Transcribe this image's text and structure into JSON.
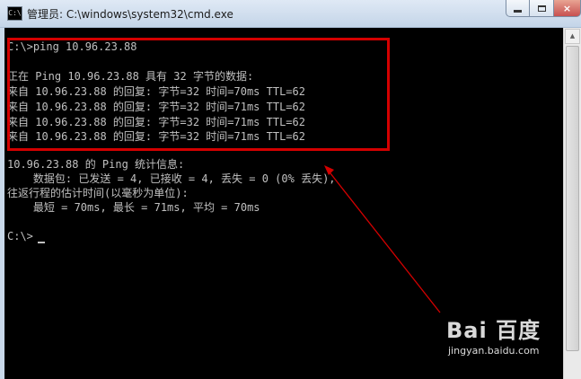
{
  "window": {
    "title": "管理员: C:\\windows\\system32\\cmd.exe",
    "app_icon_text": "C:\\",
    "controls": {
      "minimize": "minimize-icon",
      "maximize": "maximize-icon",
      "close_label": "×"
    }
  },
  "console": {
    "lines": [
      "C:\\>ping 10.96.23.88",
      "",
      "正在 Ping 10.96.23.88 具有 32 字节的数据:",
      "来自 10.96.23.88 的回复: 字节=32 时间=70ms TTL=62",
      "来自 10.96.23.88 的回复: 字节=32 时间=71ms TTL=62",
      "来自 10.96.23.88 的回复: 字节=32 时间=71ms TTL=62",
      "来自 10.96.23.88 的回复: 字节=32 时间=71ms TTL=62",
      "",
      "10.96.23.88 的 Ping 统计信息:",
      "    数据包: 已发送 = 4, 已接收 = 4, 丢失 = 0 (0% 丢失),",
      "往返行程的估计时间(以毫秒为单位):",
      "    最短 = 70ms, 最长 = 71ms, 平均 = 70ms",
      "",
      "C:\\>"
    ],
    "colors": {
      "background": "#000000",
      "text": "#c0c0c0"
    }
  },
  "annotation": {
    "box_color": "#d40000",
    "arrow_color": "#d40000"
  },
  "watermark": {
    "logo": "Bai  百度",
    "site": "jingyan.baidu.com"
  }
}
